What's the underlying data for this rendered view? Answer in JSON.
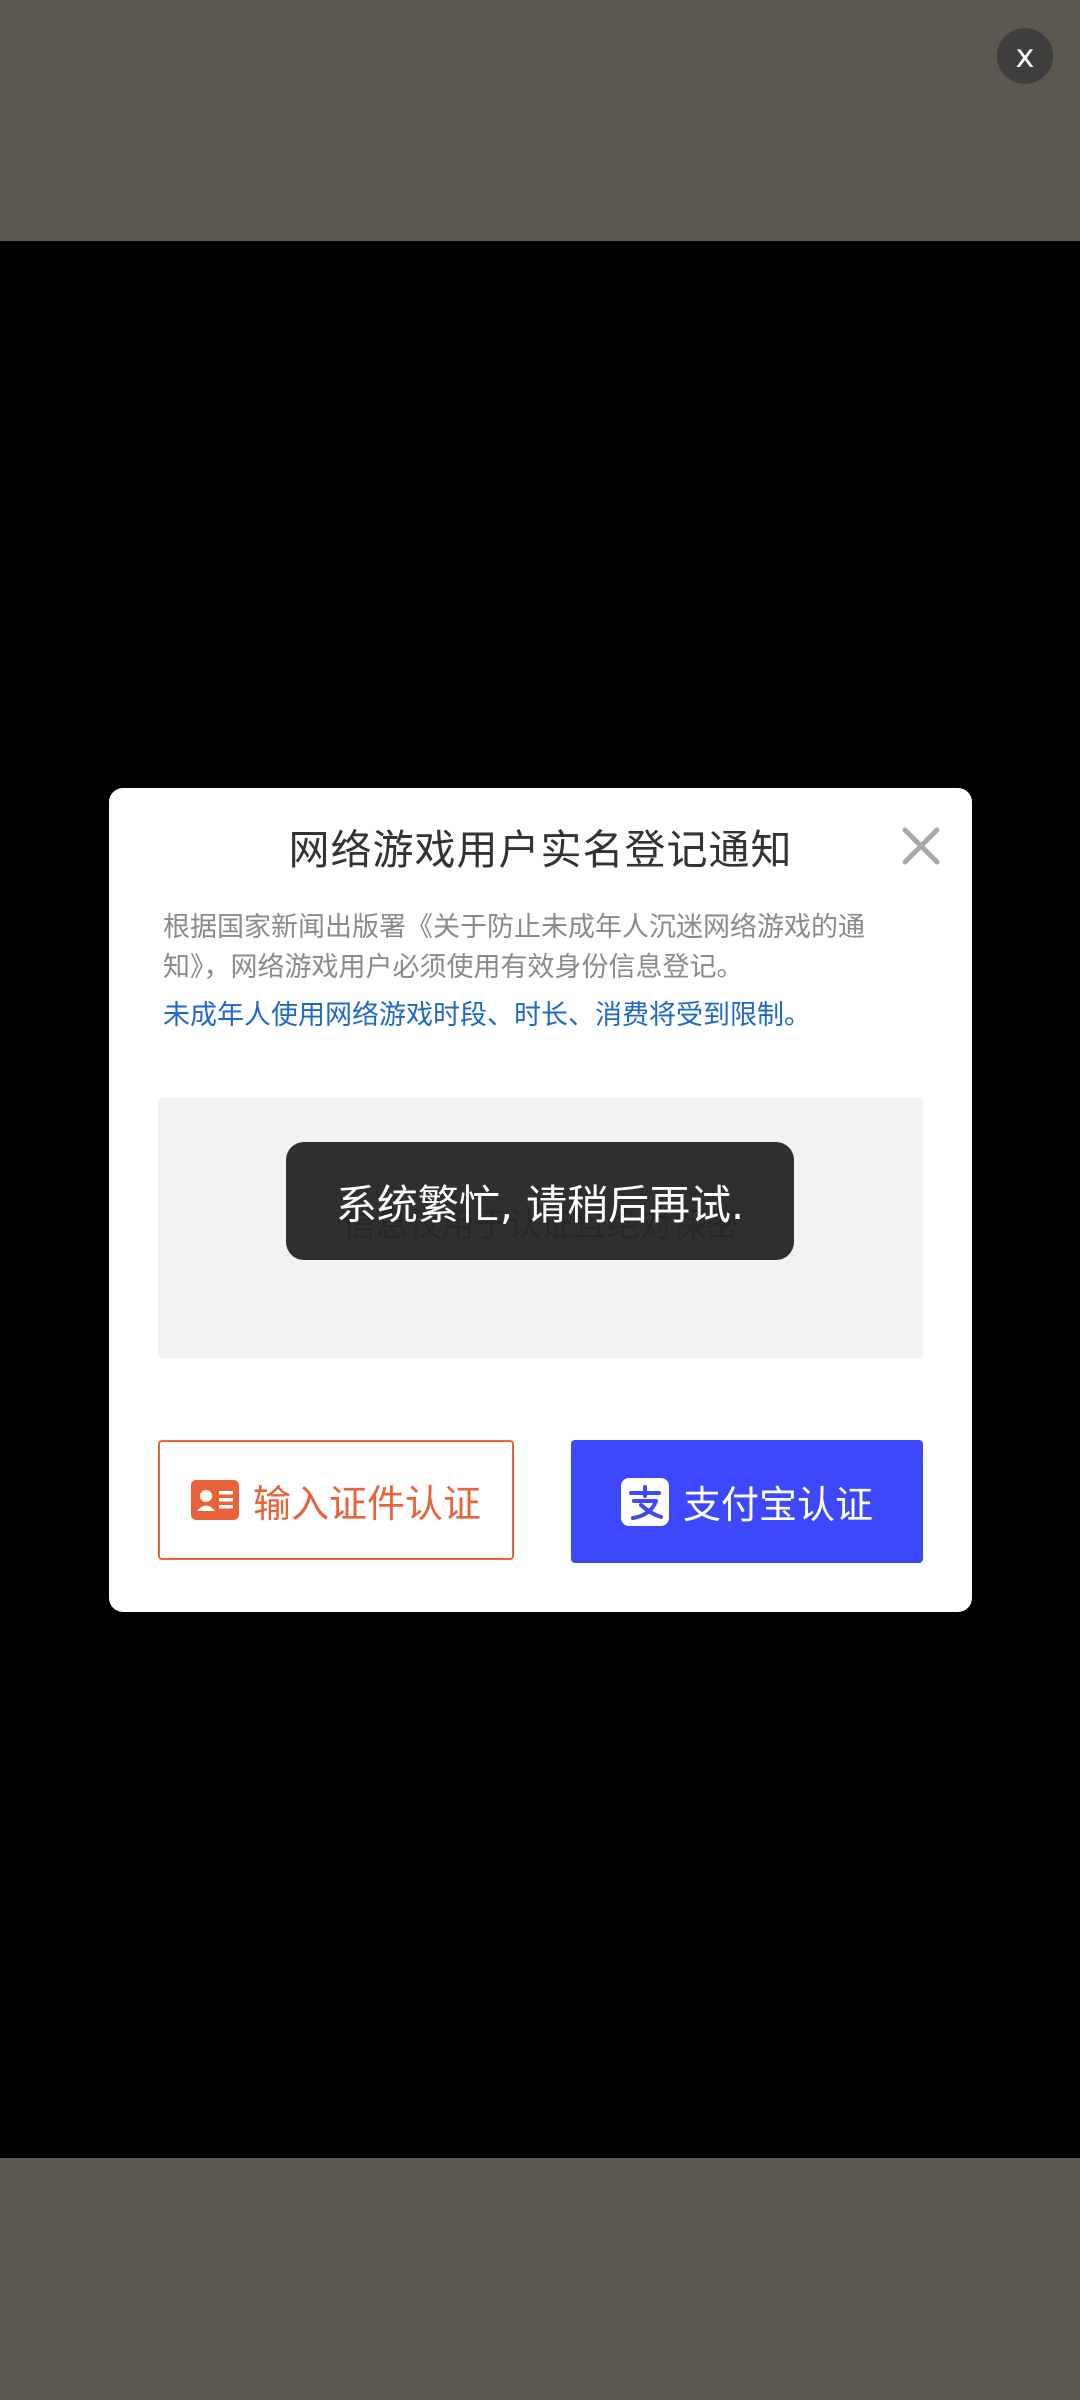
{
  "page": {
    "top_close_label": "x"
  },
  "dialog": {
    "title": "网络游戏用户实名登记通知",
    "notice": "根据国家新闻出版署《关于防止未成年人沉迷网络游戏的通知》，网络游戏用户必须使用有效身份信息登记。",
    "notice_highlight": "未成年人使用网络游戏时段、时长、消费将受到限制。",
    "info_text": "信息仅用于认证且绝对保密",
    "toast": "系统繁忙, 请稍后再试.",
    "id_button_label": "输入证件认证",
    "alipay_button_label": "支付宝认证"
  },
  "colors": {
    "band": "#5b5850",
    "id_accent": "#e9623a",
    "alipay_blue": "#3d47fb",
    "highlight_blue": "#1f68c9"
  },
  "icons": [
    "close-icon",
    "dialog-close-icon",
    "id-card-icon",
    "alipay-icon"
  ]
}
